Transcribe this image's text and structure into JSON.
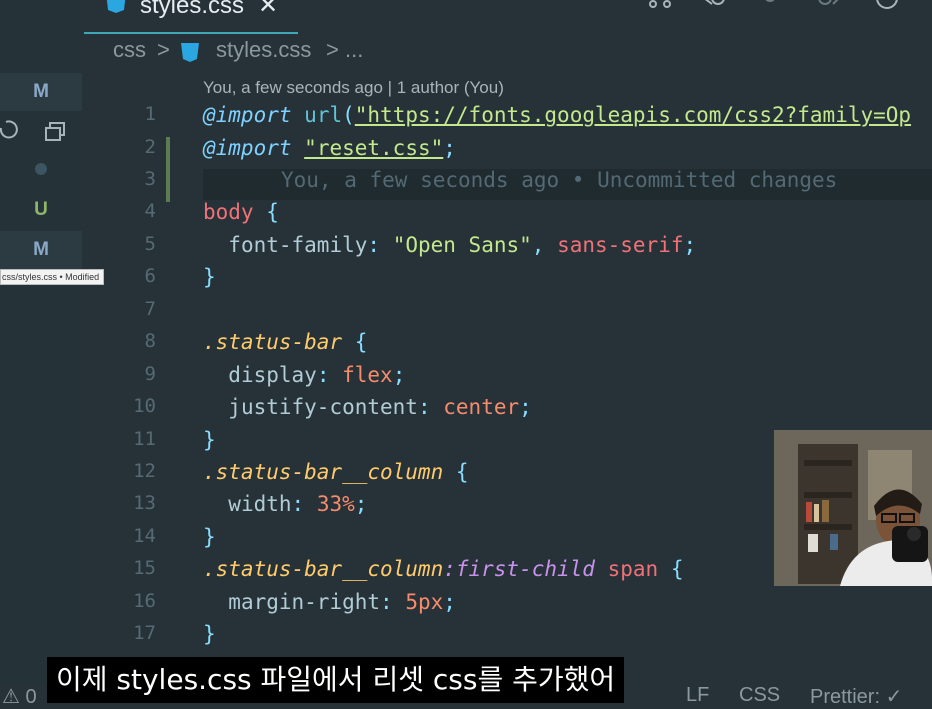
{
  "tab": {
    "title": "styles.css",
    "close_glyph": "✕",
    "file_icon": "css3-icon"
  },
  "breadcrumb": {
    "folder": "css",
    "sep": ">",
    "file": "styles.css",
    "more": "..."
  },
  "explorer_badges": [
    "M",
    "",
    "",
    "U",
    "M"
  ],
  "tooltip": "css/styles.css • Modified",
  "blame_header": "You, a few seconds ago | 1 author (You)",
  "lines": [
    {
      "n": "1"
    },
    {
      "n": "2"
    },
    {
      "n": "3"
    },
    {
      "n": "4"
    },
    {
      "n": "5"
    },
    {
      "n": "6"
    },
    {
      "n": "7"
    },
    {
      "n": "8"
    },
    {
      "n": "9"
    },
    {
      "n": "10"
    },
    {
      "n": "11"
    },
    {
      "n": "12"
    },
    {
      "n": "13"
    },
    {
      "n": "14"
    },
    {
      "n": "15"
    },
    {
      "n": "16"
    },
    {
      "n": "17"
    }
  ],
  "code": {
    "l1_kw": "@import",
    "l1_fn": "url",
    "l1_open": "(",
    "l1_url": "\"https://fonts.googleapis.com/css2?family=Op",
    "l2_kw": "@import",
    "l2_str": "\"reset.css\"",
    "l2_end": ";",
    "l3_ghost": "You, a few seconds ago • Uncommitted changes",
    "l4_sel": "body",
    "l4_brace": "{",
    "l5_prop": "font-family",
    "l5_colon": ":",
    "l5_str": "\"Open Sans\"",
    "l5_comma": ",",
    "l5_val": "sans-serif",
    "l5_end": ";",
    "l6": "}",
    "l8_sel": ".status-bar",
    "l8_brace": "{",
    "l9_prop": "display",
    "l9_val": "flex",
    "l10_prop": "justify-content",
    "l10_val": "center",
    "l11": "}",
    "l12_sel": ".status-bar__column",
    "l12_brace": "{",
    "l13_prop": "width",
    "l13_val": "33%",
    "l14": "}",
    "l15_sel": ".status-bar__column",
    "l15_pseudo": ":first-child",
    "l15_tag": "span",
    "l15_brace": "{",
    "l16_prop": "margin-right",
    "l16_val": "5px",
    "l17": "}"
  },
  "status_bar": {
    "warnings": "0",
    "eol": "LF",
    "language": "CSS",
    "formatter": "Prettier: ✓"
  },
  "subtitle": "이제 styles.css 파일에서 리셋 css를 추가했어",
  "webcam": "webcam-overlay",
  "colors": {
    "editor_bg": "#263238",
    "accent": "#3fa7b8",
    "keyword": "#7fd1ff",
    "string": "#c3e88d",
    "number": "#f78c6c",
    "selector": "#f07178",
    "class": "#ffcb6b"
  }
}
